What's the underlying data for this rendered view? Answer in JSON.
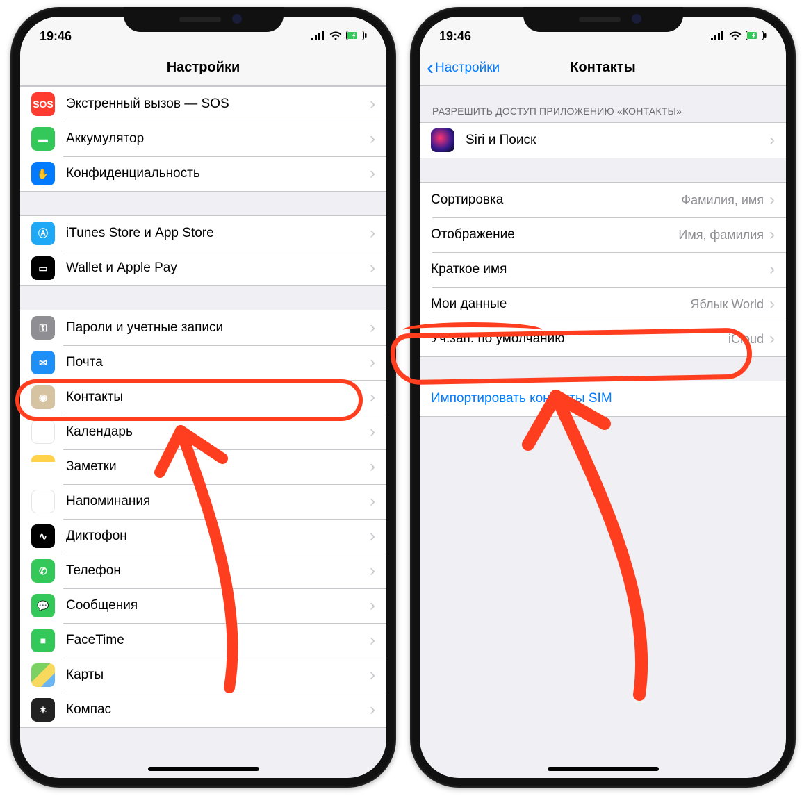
{
  "status": {
    "time": "19:46"
  },
  "left": {
    "title": "Настройки",
    "groups": [
      {
        "rows": [
          {
            "icon": "sos-icon",
            "iconClass": "ic-sos",
            "glyph": "SOS",
            "label": "Экстренный вызов — SOS"
          },
          {
            "icon": "battery-icon",
            "iconClass": "ic-bat",
            "glyph": "▬",
            "label": "Аккумулятор"
          },
          {
            "icon": "privacy-icon",
            "iconClass": "ic-priv",
            "glyph": "✋",
            "label": "Конфиденциальность"
          }
        ]
      },
      {
        "rows": [
          {
            "icon": "itunes-icon",
            "iconClass": "ic-itunes",
            "glyph": "Ⓐ",
            "label": "iTunes Store и App Store"
          },
          {
            "icon": "wallet-icon",
            "iconClass": "ic-wallet",
            "glyph": "▭",
            "label": "Wallet и Apple Pay"
          }
        ]
      },
      {
        "rows": [
          {
            "icon": "passwords-icon",
            "iconClass": "ic-pass",
            "glyph": "⚿",
            "label": "Пароли и учетные записи"
          },
          {
            "icon": "mail-icon",
            "iconClass": "ic-mail",
            "glyph": "✉",
            "label": "Почта"
          },
          {
            "icon": "contacts-icon",
            "iconClass": "ic-contacts",
            "glyph": "◉",
            "label": "Контакты"
          },
          {
            "icon": "calendar-icon",
            "iconClass": "ic-cal",
            "glyph": "",
            "label": "Календарь"
          },
          {
            "icon": "notes-icon",
            "iconClass": "ic-notes",
            "glyph": "",
            "label": "Заметки"
          },
          {
            "icon": "reminders-icon",
            "iconClass": "ic-reminders",
            "glyph": "⋮",
            "label": "Напоминания"
          },
          {
            "icon": "voice-memos-icon",
            "iconClass": "ic-voice",
            "glyph": "∿",
            "label": "Диктофон"
          },
          {
            "icon": "phone-icon",
            "iconClass": "ic-phone",
            "glyph": "✆",
            "label": "Телефон"
          },
          {
            "icon": "messages-icon",
            "iconClass": "ic-msg",
            "glyph": "💬",
            "label": "Сообщения"
          },
          {
            "icon": "facetime-icon",
            "iconClass": "ic-facetime",
            "glyph": "■",
            "label": "FaceTime"
          },
          {
            "icon": "maps-icon",
            "iconClass": "ic-maps",
            "glyph": "",
            "label": "Карты"
          },
          {
            "icon": "compass-icon",
            "iconClass": "ic-compass",
            "glyph": "✶",
            "label": "Компас"
          }
        ]
      }
    ]
  },
  "right": {
    "back": "Настройки",
    "title": "Контакты",
    "section_header": "РАЗРЕШИТЬ ДОСТУП ПРИЛОЖЕНИЮ «КОНТАКТЫ»",
    "siri_row": {
      "label": "Siri и Поиск"
    },
    "settings_rows": [
      {
        "label": "Сортировка",
        "value": "Фамилия, имя"
      },
      {
        "label": "Отображение",
        "value": "Имя, фамилия"
      },
      {
        "label": "Краткое имя",
        "value": ""
      },
      {
        "label": "Мои данные",
        "value": "Яблык World"
      },
      {
        "label": "Уч.зап. по умолчанию",
        "value": "iCloud"
      }
    ],
    "import_row": "Импортировать контакты SIM"
  }
}
